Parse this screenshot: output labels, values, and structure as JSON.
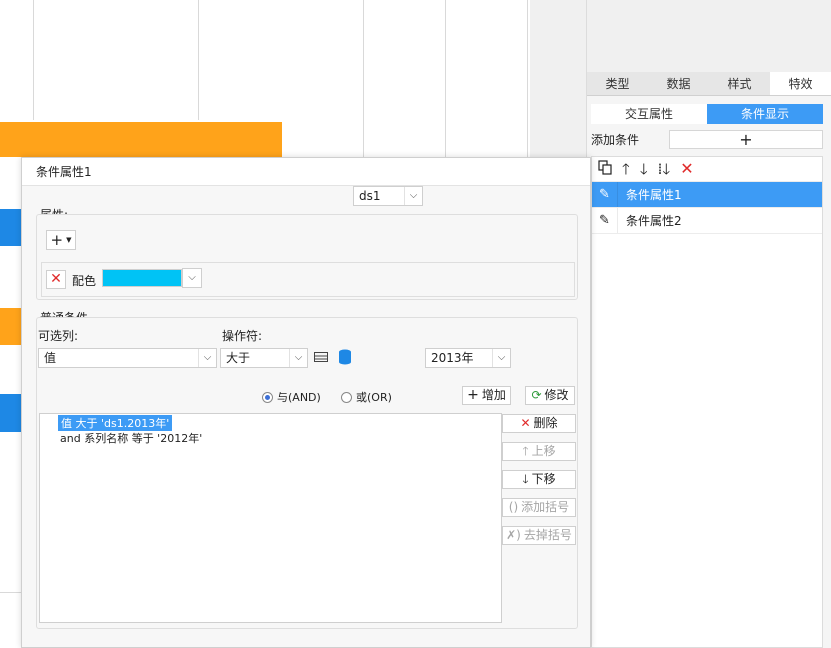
{
  "right_panel": {
    "tabs": [
      {
        "label": "类型",
        "active": false
      },
      {
        "label": "数据",
        "active": false
      },
      {
        "label": "样式",
        "active": false
      },
      {
        "label": "特效",
        "active": true
      }
    ],
    "subtabs": [
      {
        "label": "交互属性",
        "active": false
      },
      {
        "label": "条件显示",
        "active": true
      }
    ],
    "add_condition_label": "添加条件",
    "add_button": "+",
    "toolbar_icons": [
      "copy-icon",
      "arrow-up-icon",
      "arrow-down-icon",
      "sort-icon",
      "delete-icon"
    ],
    "items": [
      {
        "label": "条件属性1",
        "active": true
      },
      {
        "label": "条件属性2",
        "active": false
      }
    ]
  },
  "dialog": {
    "title": "条件属性1",
    "attributes_label": "属性:",
    "add_attr_icon": "+",
    "color_attr_label": "配色",
    "color_value": "#00c3f5",
    "normal_conditions_label": "普通条件",
    "optional_column_label": "可选列:",
    "operator_label": "操作符:",
    "column_value": "值",
    "operator_value": "大于",
    "dataset_value": "ds1",
    "year_value": "2013年",
    "radio_and": "与(AND)",
    "radio_or": "或(OR)",
    "add_button": "增加",
    "modify_button": "修改",
    "delete_button": "删除",
    "move_up_button": "上移",
    "move_down_button": "下移",
    "add_bracket_button": "添加括号",
    "remove_bracket_button": "去掉括号",
    "conditions": [
      "值 大于 'ds1.2013年'",
      "and 系列名称 等于 '2012年'"
    ]
  },
  "colors": {
    "accent": "#3d9bf5",
    "orange": "#ffa31a",
    "blue_bar": "#1e88e5",
    "color_swatch": "#00c3f5"
  }
}
